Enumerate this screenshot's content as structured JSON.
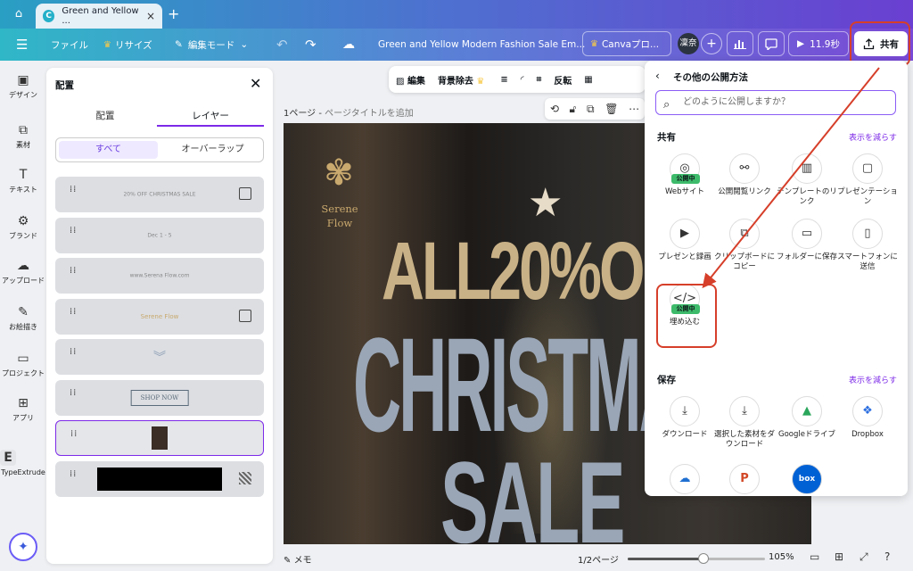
{
  "browser": {
    "tab_title": "Green and Yellow ...",
    "tab_logo": "C"
  },
  "toolbar": {
    "file": "ファイル",
    "resize": "リサイズ",
    "edit_mode": "編集モード",
    "doc_title": "Green and Yellow Modern Fashion Sale Em...",
    "canva_pro": "Canvaプロ...",
    "avatar": "凜奈",
    "play_time": "11.9秒",
    "share": "共有"
  },
  "left_rail": [
    {
      "label": "デザイン",
      "icon": "design-icon",
      "glyph": "▣"
    },
    {
      "label": "素材",
      "icon": "elements-icon",
      "glyph": "⧉"
    },
    {
      "label": "テキスト",
      "icon": "text-icon",
      "glyph": "T"
    },
    {
      "label": "ブランド",
      "icon": "brand-icon",
      "glyph": "⚙"
    },
    {
      "label": "アップロード",
      "icon": "upload-icon",
      "glyph": "☁"
    },
    {
      "label": "お絵描き",
      "icon": "draw-icon",
      "glyph": "✎"
    },
    {
      "label": "プロジェクト",
      "icon": "folder-icon",
      "glyph": "▭"
    },
    {
      "label": "アプリ",
      "icon": "apps-icon",
      "glyph": "⊞"
    },
    {
      "label": "TypeExtrude",
      "icon": "typeextrude-icon",
      "glyph": "E"
    }
  ],
  "position_panel": {
    "title": "配置",
    "tab_arrange": "配置",
    "tab_layers": "レイヤー",
    "filter_all": "すべて",
    "filter_overlap": "オーバーラップ",
    "layers": [
      {
        "thumb": "20% OFF CHRISTMAS SALE"
      },
      {
        "thumb": "Dec 1 - 5"
      },
      {
        "thumb": "www.Serena Flow.com"
      },
      {
        "thumb": "Serene Flow"
      },
      {
        "thumb": "︾"
      },
      {
        "thumb": "SHOP NOW"
      },
      {
        "thumb": ""
      },
      {
        "thumb": ""
      }
    ]
  },
  "context_bar": {
    "edit": "編集",
    "bg_remove": "背景除去",
    "flip": "反転"
  },
  "page": {
    "label": "1ページ",
    "add_title": "ページタイトルを追加"
  },
  "design": {
    "brand_line1": "Serene",
    "brand_line2": "Flow",
    "promo_line1": "ALL20%OFF",
    "promo_line2": "CHRISTMAS",
    "promo_line3": "SALE"
  },
  "bottom_bar": {
    "memo": "メモ",
    "page_count": "1/2ページ",
    "zoom": "105%",
    "zoom_level": 0.55
  },
  "share_panel": {
    "title": "その他の公開方法",
    "search_placeholder": "どのように公開しますか？",
    "share_section": "共有",
    "show_less": "表示を減らす",
    "share_options": [
      {
        "label": "Webサイト",
        "icon": "website-icon",
        "glyph": "◎",
        "badge": "公開中"
      },
      {
        "label": "公開閲覧リンク",
        "icon": "link-icon",
        "glyph": "⚯",
        "badge": ""
      },
      {
        "label": "テンプレートのリンク",
        "icon": "template-icon",
        "glyph": "▥",
        "badge": ""
      },
      {
        "label": "プレゼンテーション",
        "icon": "presentation-icon",
        "glyph": "▢",
        "badge": ""
      },
      {
        "label": "プレゼンと録画",
        "icon": "record-icon",
        "glyph": "▶",
        "badge": ""
      },
      {
        "label": "クリップボードにコピー",
        "icon": "clipboard-icon",
        "glyph": "⧉",
        "badge": ""
      },
      {
        "label": "フォルダーに保存",
        "icon": "folder-icon",
        "glyph": "▭",
        "badge": ""
      },
      {
        "label": "スマートフォンに送信",
        "icon": "phone-icon",
        "glyph": "▯",
        "badge": ""
      },
      {
        "label": "埋め込む",
        "icon": "embed-icon",
        "glyph": "</>",
        "badge": "公開中"
      }
    ],
    "save_section": "保存",
    "save_less": "表示を減らす",
    "save_options": [
      {
        "label": "ダウンロード",
        "icon": "download-icon",
        "glyph": "⤓"
      },
      {
        "label": "選択した素材をダウンロード",
        "icon": "download-selected-icon",
        "glyph": "⤓"
      },
      {
        "label": "Googleドライブ",
        "icon": "google-drive-icon",
        "glyph": "▲"
      },
      {
        "label": "Dropbox",
        "icon": "dropbox-icon",
        "glyph": "❖"
      }
    ],
    "more_options": [
      {
        "icon": "onedrive-icon",
        "glyph": "☁"
      },
      {
        "icon": "powerpoint-icon",
        "glyph": "P"
      },
      {
        "icon": "box-icon",
        "glyph": "box"
      }
    ]
  },
  "colors": {
    "accent": "#7d2ae8",
    "highlight": "#d63f2a",
    "badge_green": "#3dbb6b"
  }
}
